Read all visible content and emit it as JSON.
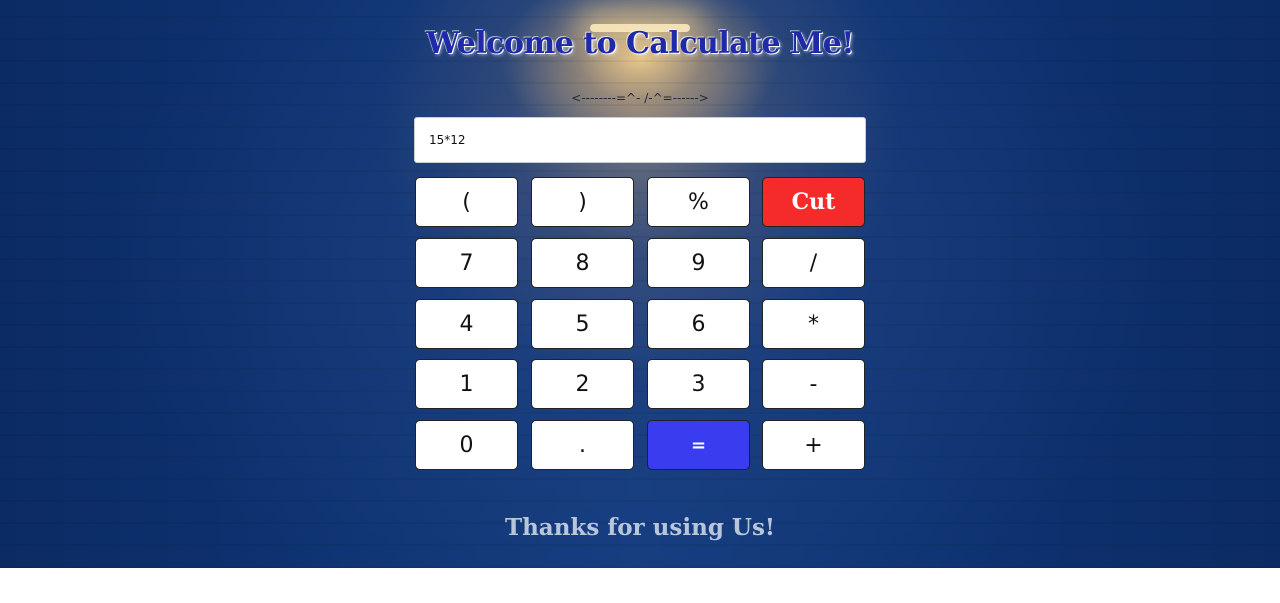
{
  "header": {
    "title": "Welcome to Calculate Me!",
    "divider": "<--------=^- /-^=------>"
  },
  "display": {
    "value": "15*12"
  },
  "keys": [
    {
      "label": "(",
      "name": "open-paren-button"
    },
    {
      "label": ")",
      "name": "close-paren-button"
    },
    {
      "label": "%",
      "name": "percent-button"
    },
    {
      "label": "Cut",
      "name": "cut-button"
    },
    {
      "label": "7",
      "name": "digit-7-button"
    },
    {
      "label": "8",
      "name": "digit-8-button"
    },
    {
      "label": "9",
      "name": "digit-9-button"
    },
    {
      "label": "/",
      "name": "divide-button"
    },
    {
      "label": "4",
      "name": "digit-4-button"
    },
    {
      "label": "5",
      "name": "digit-5-button"
    },
    {
      "label": "6",
      "name": "digit-6-button"
    },
    {
      "label": "*",
      "name": "multiply-button"
    },
    {
      "label": "1",
      "name": "digit-1-button"
    },
    {
      "label": "2",
      "name": "digit-2-button"
    },
    {
      "label": "3",
      "name": "digit-3-button"
    },
    {
      "label": "-",
      "name": "subtract-button"
    },
    {
      "label": "0",
      "name": "digit-0-button"
    },
    {
      "label": ".",
      "name": "decimal-point-button"
    },
    {
      "label": "=",
      "name": "equals-button"
    },
    {
      "label": "+",
      "name": "add-button"
    }
  ],
  "footer": {
    "text": "Thanks for using Us!"
  },
  "colors": {
    "title": "#1f2aa8",
    "cut_key": "#f52b2b",
    "equals_key": "#3a3cf0",
    "footer_text": "#b8c6dc",
    "background": "#0e3372"
  }
}
